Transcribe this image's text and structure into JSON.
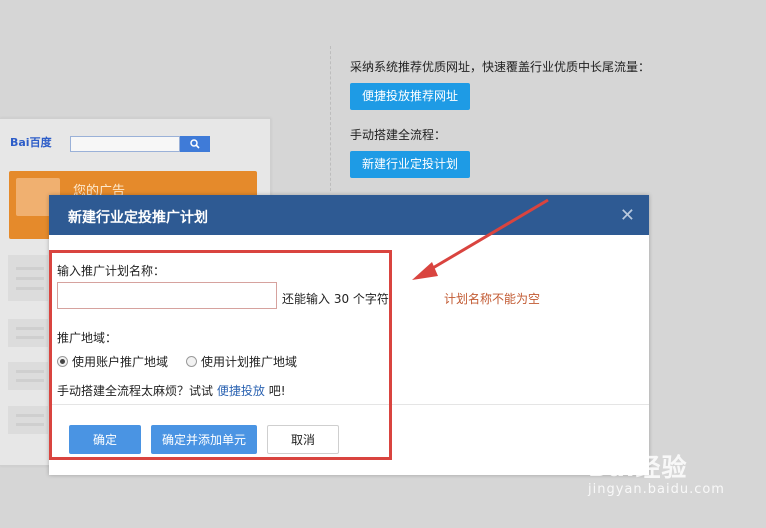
{
  "background": {
    "baidu_logo": "Bai百度",
    "ad_title": "您的广告",
    "recommend_text": "采纳系统推荐优质网址，快速覆盖行业优质中长尾流量：",
    "recommend_button": "便捷投放推荐网址",
    "manual_text": "手动搭建全流程：",
    "new_plan_button": "新建行业定投计划"
  },
  "dialog": {
    "title": "新建行业定投推广计划",
    "close": "✕",
    "name_label": "输入推广计划名称：",
    "name_value": "",
    "remain_text": "还能输入 30 个字符",
    "error_text": "计划名称不能为空",
    "region_label": "推广地域：",
    "region_options": [
      {
        "label": "使用账户推广地域",
        "checked": true
      },
      {
        "label": "使用计划推广地域",
        "checked": false
      }
    ],
    "hint_prefix": "手动搭建全流程太麻烦？试试",
    "hint_link": "便捷投放",
    "hint_suffix": "吧!",
    "confirm_button": "确定",
    "confirm_add_button": "确定并添加单元",
    "cancel_button": "取消"
  },
  "colors": {
    "header": "#2e5a93",
    "primary_button": "#4a94e3",
    "bg_button": "#1e9be5",
    "annotation": "#d9443f",
    "error": "#c25a32"
  },
  "watermark": {
    "logo": "Bai经验",
    "url": "jingyan.baidu.com"
  }
}
